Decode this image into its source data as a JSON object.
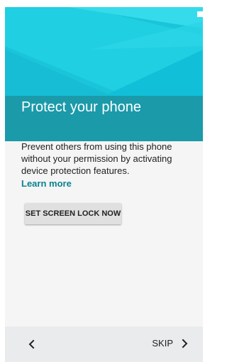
{
  "setup": {
    "title": "Protect your phone",
    "description": "Prevent others from using this phone without your permission by activating device protection features.",
    "learn_more": "Learn more",
    "primary_button": "SET SCREEN LOCK NOW"
  },
  "nav": {
    "back_icon": "chevron-left-icon",
    "skip_label": "SKIP",
    "skip_icon": "chevron-right-icon"
  },
  "colors": {
    "hero_primary": "#1ac4d9",
    "title_band": "#1b9aaa",
    "link": "#0b8290",
    "button": "#e0e0e0",
    "nav_bar": "#e9ebed",
    "background": "#f5f5f5"
  }
}
